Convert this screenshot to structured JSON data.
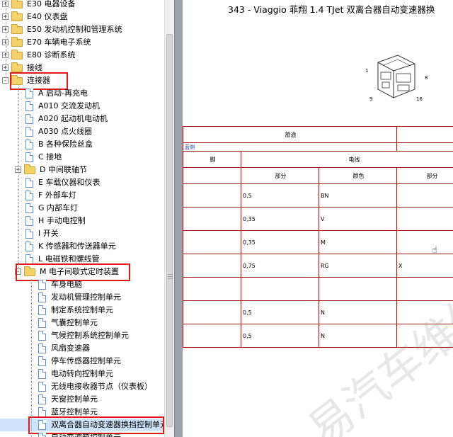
{
  "tree": [
    {
      "label": "E30 电器设备",
      "type": "folder",
      "expander": "+",
      "level": 0
    },
    {
      "label": "E40 仪表盘",
      "type": "folder",
      "expander": "+",
      "level": 0
    },
    {
      "label": "E50 发动机控制和管理系统",
      "type": "folder",
      "expander": "+",
      "level": 0
    },
    {
      "label": "E70 车辆电子系统",
      "type": "folder",
      "expander": "+",
      "level": 0
    },
    {
      "label": "E80 诊断系统",
      "type": "folder",
      "expander": "+",
      "level": 0
    },
    {
      "label": "接线",
      "type": "folder",
      "expander": "+",
      "level": 0
    },
    {
      "label": "连接器",
      "type": "folder",
      "expander": "-",
      "level": 0,
      "highlight": true
    },
    {
      "label": "A 启动-再充电",
      "type": "doc",
      "level": 1
    },
    {
      "label": "A010 交流发动机",
      "type": "doc",
      "level": 1
    },
    {
      "label": "A020 起动机电动机",
      "type": "doc",
      "level": 1
    },
    {
      "label": "A030 点火线圈",
      "type": "doc",
      "level": 1
    },
    {
      "label": "B 各种保险丝盒",
      "type": "doc",
      "level": 1
    },
    {
      "label": "C 接地",
      "type": "doc",
      "level": 1
    },
    {
      "label": "D 中间联轴节",
      "type": "folder",
      "expander": "+",
      "level": 1
    },
    {
      "label": "E 车载仪器和仪表",
      "type": "doc",
      "level": 1
    },
    {
      "label": "F 外部车灯",
      "type": "doc",
      "level": 1
    },
    {
      "label": "G 内部车灯",
      "type": "doc",
      "level": 1
    },
    {
      "label": "H 手动电控制",
      "type": "doc",
      "level": 1
    },
    {
      "label": "I 开关",
      "type": "doc",
      "level": 1
    },
    {
      "label": "K 传感器和传送器单元",
      "type": "doc",
      "level": 1
    },
    {
      "label": "L 电磁铁和螺线管",
      "type": "doc",
      "level": 1
    },
    {
      "label": "M 电子间歇式定时装置",
      "type": "folder",
      "expander": "-",
      "level": 1,
      "highlight": true
    },
    {
      "label": "车身电脑",
      "type": "doc",
      "level": 2
    },
    {
      "label": "发动机管理控制单元",
      "type": "doc",
      "level": 2
    },
    {
      "label": "制定系统控制单元",
      "type": "doc",
      "level": 2
    },
    {
      "label": "气囊控制单元",
      "type": "doc",
      "level": 2
    },
    {
      "label": "气候控制系统控制单元",
      "type": "doc",
      "level": 2
    },
    {
      "label": "风扇变速器",
      "type": "doc",
      "level": 2
    },
    {
      "label": "停车传感器控制单元",
      "type": "doc",
      "level": 2
    },
    {
      "label": "电动转向控制单元",
      "type": "doc",
      "level": 2
    },
    {
      "label": "无线电接收器节点（仪表板）",
      "type": "doc",
      "level": 2
    },
    {
      "label": "天窗控制单元",
      "type": "doc",
      "level": 2
    },
    {
      "label": "蓝牙控制单元",
      "type": "doc",
      "level": 2
    },
    {
      "label": "双离合器自动变速器换挡控制单元",
      "type": "doc",
      "level": 2,
      "highlight": true,
      "selected": true
    },
    {
      "label": "自动变速箱控制单元",
      "type": "doc",
      "level": 2
    }
  ],
  "document": {
    "title": "343 - Viaggio 菲翔    1.4 TJet    双离合器自动变速器换",
    "connector_pins": {
      "p1": "1",
      "p8": "8",
      "p9": "9",
      "p16": "16"
    },
    "table": {
      "head1": "旅途",
      "head2": "蓝侧",
      "head3": "脚",
      "head4": "电线",
      "sub1": "部分",
      "sub2": "颜色",
      "sub3": "部分",
      "rows": [
        {
          "section": "0,5",
          "color": "BN",
          "extra": ""
        },
        {
          "section": "0,35",
          "color": "V",
          "extra": ""
        },
        {
          "section": "0,35",
          "color": "M",
          "extra": ""
        },
        {
          "section": "0,75",
          "color": "RG",
          "extra": "X"
        },
        {
          "section": "",
          "color": "",
          "extra": ""
        },
        {
          "section": "0,5",
          "color": "N",
          "extra": ""
        },
        {
          "section": "0,5",
          "color": "N",
          "extra": ""
        }
      ]
    },
    "watermark": "易汽车维修"
  }
}
